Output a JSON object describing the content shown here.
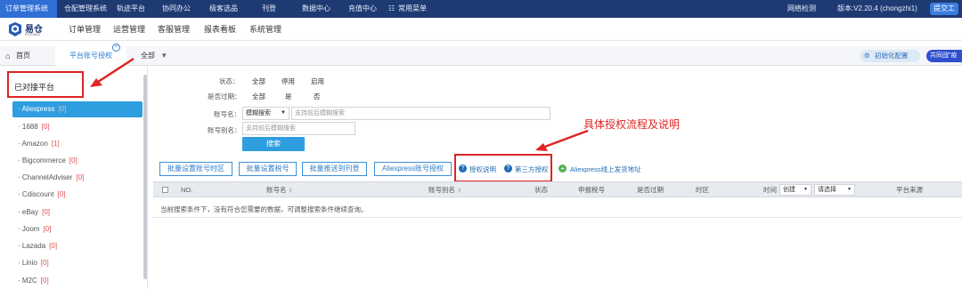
{
  "topbar": {
    "items": [
      "订单管理系统",
      "仓配管理系统",
      "轨迹平台",
      "协同办公",
      "极客选品",
      "刊登",
      "数据中心",
      "充值中心",
      "常用菜单"
    ],
    "network_check": "网络检测",
    "version": "版本:V2.20.4 (chongzhi1)",
    "submit": "提交工"
  },
  "logo": {
    "name": "易仓",
    "sub": "ECCANG"
  },
  "menu": {
    "items": [
      "订单管理",
      "运营管理",
      "客服管理",
      "报表看板",
      "系统管理"
    ]
  },
  "tabs": {
    "home": "首页",
    "active": "平台账号授权",
    "filter_value": "全部",
    "init_config": "初始化配置",
    "shared": "共同战\"疫"
  },
  "sidebar": {
    "title": "已对接平台",
    "items": [
      {
        "name": "Aliexpress",
        "count": "[0]"
      },
      {
        "name": "1688",
        "count": "[0]"
      },
      {
        "name": "Amazon",
        "count": "[1]"
      },
      {
        "name": "Bigcommerce",
        "count": "[0]"
      },
      {
        "name": "ChannelAdviser",
        "count": "[0]"
      },
      {
        "name": "Cdiscount",
        "count": "[0]"
      },
      {
        "name": "eBay",
        "count": "[0]"
      },
      {
        "name": "Joom",
        "count": "[0]"
      },
      {
        "name": "Lazada",
        "count": "[0]"
      },
      {
        "name": "Linio",
        "count": "[0]"
      },
      {
        "name": "M2C",
        "count": "[0]"
      }
    ]
  },
  "filters": {
    "status_label": "状态：",
    "status_options": [
      "全部",
      "停用",
      "启用"
    ],
    "expired_label": "是否过期：",
    "expired_options": [
      "全部",
      "是",
      "否"
    ],
    "account_label": "账号名：",
    "account_mode": "模糊搜索",
    "account_placeholder": "支持前后模糊搜索",
    "alias_label": "账号别名：",
    "alias_placeholder": "支持前后模糊搜索",
    "search_button": "搜索"
  },
  "annotation": {
    "text": "具体授权流程及说明"
  },
  "actions": {
    "buttons": [
      "批量设置账号时区",
      "批量设置税号",
      "批量推送到刊登",
      "Aliexpress账号授权"
    ],
    "auth_help": "授权说明",
    "third_party": "第三方授权",
    "ship_address": "Aliexpress线上发货地址"
  },
  "table": {
    "columns": [
      "NO.",
      "账号名",
      "账号别名",
      "状态",
      "申报税号",
      "是否过期",
      "时区",
      "时间",
      "平台来源"
    ],
    "time_select": "创建",
    "choose_select": "请选择",
    "empty_message": "当前搜索条件下，没有符合您需要的数据，可调整搜索条件继续查询。"
  },
  "colors": {
    "topbar": "#1e3a73",
    "accent": "#2f9ee0",
    "annotation": "#e02424"
  }
}
